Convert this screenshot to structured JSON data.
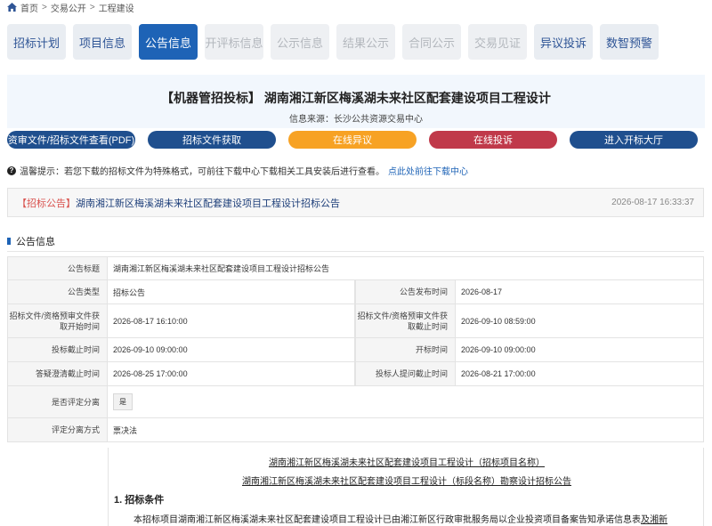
{
  "breadcrumb": {
    "home": "首页",
    "level1": "交易公开",
    "level2": "工程建设"
  },
  "tabs": [
    {
      "label": "招标计划",
      "state": "normal"
    },
    {
      "label": "项目信息",
      "state": "normal"
    },
    {
      "label": "公告信息",
      "state": "active"
    },
    {
      "label": "开评标信息",
      "state": "muted"
    },
    {
      "label": "公示信息",
      "state": "muted"
    },
    {
      "label": "结果公示",
      "state": "muted"
    },
    {
      "label": "合同公示",
      "state": "muted"
    },
    {
      "label": "交易见证",
      "state": "muted"
    },
    {
      "label": "异议投诉",
      "state": "normal"
    },
    {
      "label": "数智预警",
      "state": "normal"
    }
  ],
  "header": {
    "title": "【机器管招投标】 湖南湘江新区梅溪湖未来社区配套建设项目工程设计",
    "source": "信息来源：长沙公共资源交易中心"
  },
  "actions": {
    "doc_view": "资审文件/招标文件查看(PDF)",
    "doc_get": "招标文件获取",
    "objection": "在线异议",
    "complaint": "在线投诉",
    "enter_hall": "进入开标大厅"
  },
  "tip": {
    "text": "温馨提示：若您下载的招标文件为特殊格式，可前往下载中心下载相关工具安装后进行查看。",
    "link": "点此处前往下载中心"
  },
  "notice": {
    "tag": "【招标公告】",
    "title": "湖南湘江新区梅溪湖未来社区配套建设项目工程设计招标公告",
    "time": "2026-08-17 16:33:37"
  },
  "section": {
    "title": "公告信息"
  },
  "info": {
    "ann_title_label": "公告标题",
    "ann_title": "湖南湘江新区梅溪湖未来社区配套建设项目工程设计招标公告",
    "ann_type_label": "公告类型",
    "ann_type": "招标公告",
    "pub_time_label": "公告发布时间",
    "pub_time": "2026-08-17",
    "doc_start_label": "招标文件/资格预审文件获取开始时间",
    "doc_start": "2026-08-17 16:10:00",
    "doc_end_label": "招标文件/资格预审文件获取截止时间",
    "doc_end": "2026-09-10 08:59:00",
    "bid_deadline_label": "投标截止时间",
    "bid_deadline": "2026-09-10 09:00:00",
    "open_time_label": "开标时间",
    "open_time": "2026-09-10 09:00:00",
    "qa_deadline_label": "答疑澄清截止时间",
    "qa_deadline": "2026-08-25 17:00:00",
    "question_deadline_label": "投标人提问截止时间",
    "question_deadline": "2026-08-21 17:00:00",
    "separate_label": "是否评定分离",
    "separate": "是",
    "method_label": "评定分离方式",
    "method": "票决法"
  },
  "article": {
    "line1": "湖南湘江新区梅溪湖未来社区配套建设项目工程设计（招标项目名称）",
    "line2": "湖南湘江新区梅溪湖未来社区配套建设项目工程设计（标段名称）勘察设计招标公告",
    "heading": "1. 招标条件",
    "body": "本招标项目湖南湘江新区梅溪湖未来社区配套建设项目工程设计已由湘江新区行政审批服务局以企业投资项目备案告知承诺信息表",
    "body_tail": "及湘新"
  }
}
